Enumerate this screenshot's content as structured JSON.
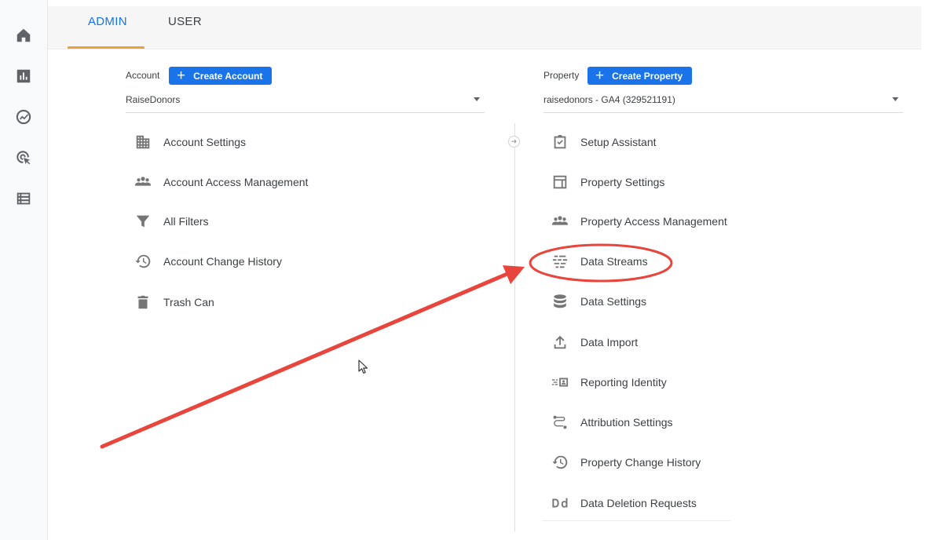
{
  "nav": {
    "items": [
      {
        "name": "home-icon"
      },
      {
        "name": "reports-icon"
      },
      {
        "name": "explore-icon"
      },
      {
        "name": "advertising-icon"
      },
      {
        "name": "configure-icon"
      }
    ]
  },
  "tabs": {
    "admin": "ADMIN",
    "user": "USER"
  },
  "account": {
    "label": "Account",
    "create_label": "Create Account",
    "selected": "RaiseDonors",
    "items": [
      {
        "label": "Account Settings",
        "icon": "building-icon"
      },
      {
        "label": "Account Access Management",
        "icon": "people-icon"
      },
      {
        "label": "All Filters",
        "icon": "filter-icon"
      },
      {
        "label": "Account Change History",
        "icon": "history-icon"
      },
      {
        "label": "Trash Can",
        "icon": "trash-icon"
      }
    ]
  },
  "property": {
    "label": "Property",
    "create_label": "Create Property",
    "selected": "raisedonors - GA4 (329521191)",
    "items": [
      {
        "label": "Setup Assistant",
        "icon": "checkbox-icon"
      },
      {
        "label": "Property Settings",
        "icon": "layout-icon"
      },
      {
        "label": "Property Access Management",
        "icon": "people-icon"
      },
      {
        "label": "Data Streams",
        "icon": "data-streams-icon"
      },
      {
        "label": "Data Settings",
        "icon": "database-icon"
      },
      {
        "label": "Data Import",
        "icon": "upload-icon"
      },
      {
        "label": "Reporting Identity",
        "icon": "reporting-identity-icon"
      },
      {
        "label": "Attribution Settings",
        "icon": "attribution-icon"
      },
      {
        "label": "Property Change History",
        "icon": "history-icon"
      },
      {
        "label": "Data Deletion Requests",
        "icon": "data-deletion-icon"
      }
    ]
  },
  "annotation": {
    "color": "#e8453c"
  },
  "colors": {
    "accent": "#1a73e8",
    "tab_underline": "#e8a23d"
  }
}
